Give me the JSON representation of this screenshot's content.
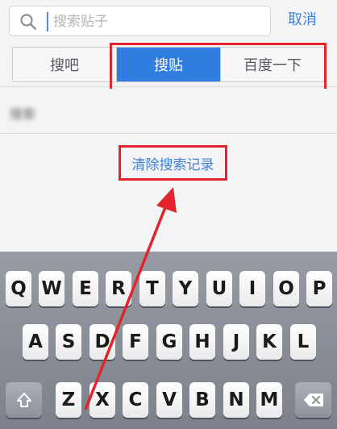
{
  "search": {
    "placeholder": "搜索贴子",
    "cancel_label": "取消"
  },
  "tabs": [
    {
      "label": "搜吧",
      "active": false
    },
    {
      "label": "搜贴",
      "active": true
    },
    {
      "label": "百度一下",
      "active": false
    }
  ],
  "history": {
    "items": [
      "搜索"
    ],
    "clear_label": "清除搜索记录"
  },
  "keyboard": {
    "row1": [
      "Q",
      "W",
      "E",
      "R",
      "T",
      "Y",
      "U",
      "I",
      "O",
      "P"
    ],
    "row2": [
      "A",
      "S",
      "D",
      "F",
      "G",
      "H",
      "J",
      "K",
      "L"
    ],
    "row3": [
      "Z",
      "X",
      "C",
      "V",
      "B",
      "N",
      "M"
    ],
    "shift_icon": "shift-icon",
    "delete_icon": "backspace-icon"
  },
  "colors": {
    "accent": "#2e7ddf",
    "link": "#3d82d8",
    "annotation": "#e2252c"
  }
}
